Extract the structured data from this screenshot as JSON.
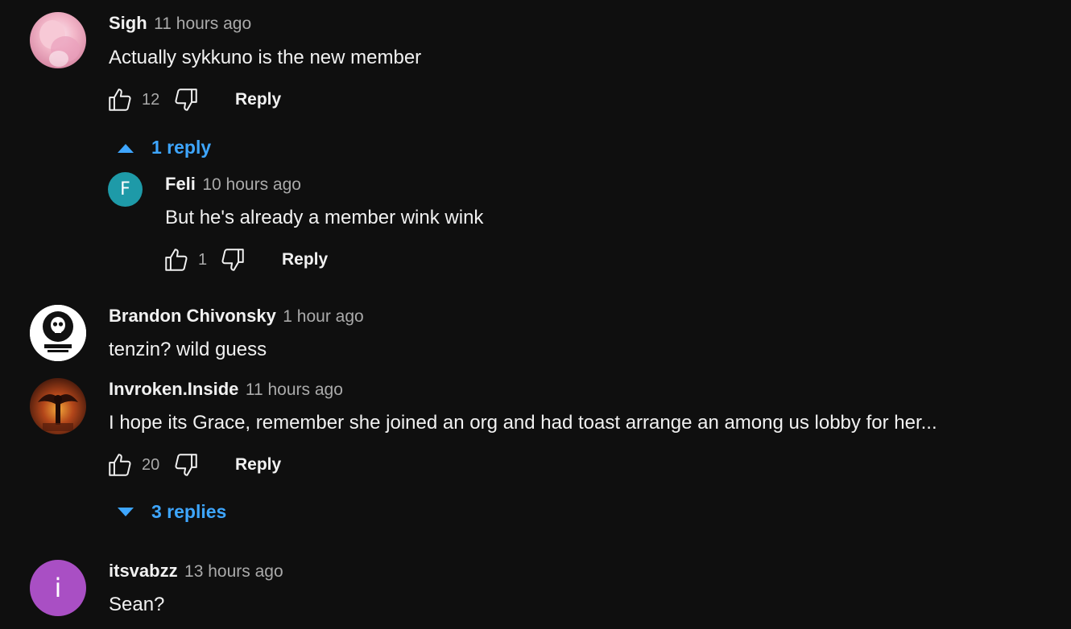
{
  "comments": [
    {
      "author": "Sigh",
      "time": "11 hours ago",
      "text": "Actually sykkuno is the new member",
      "likes": "12",
      "reply_label": "Reply",
      "replies_toggle": "1 reply"
    },
    {
      "author": "Feli",
      "avatar_letter": "F",
      "avatar_color": "#1e9aa8",
      "time": "10 hours ago",
      "text": "But he's already a member wink wink",
      "likes": "1",
      "reply_label": "Reply"
    },
    {
      "author": "Brandon Chivonsky",
      "time": "1 hour ago",
      "text": "tenzin? wild guess"
    },
    {
      "author": "Invroken.Inside",
      "time": "11 hours ago",
      "text": "I hope its Grace, remember she joined an org and had toast arrange an among us lobby for her...",
      "likes": "20",
      "reply_label": "Reply",
      "replies_toggle": "3 replies"
    },
    {
      "author": "itsvabzz",
      "avatar_letter": "i",
      "avatar_color": "#a94fc4",
      "time": "13 hours ago",
      "text": "Sean?"
    }
  ],
  "colors": {
    "background": "#0f0f0f",
    "link": "#3ea6ff",
    "secondary_text": "#aaaaaa"
  },
  "icons": [
    "thumb-up-icon",
    "thumb-down-icon",
    "caret-up-icon",
    "caret-down-icon"
  ]
}
